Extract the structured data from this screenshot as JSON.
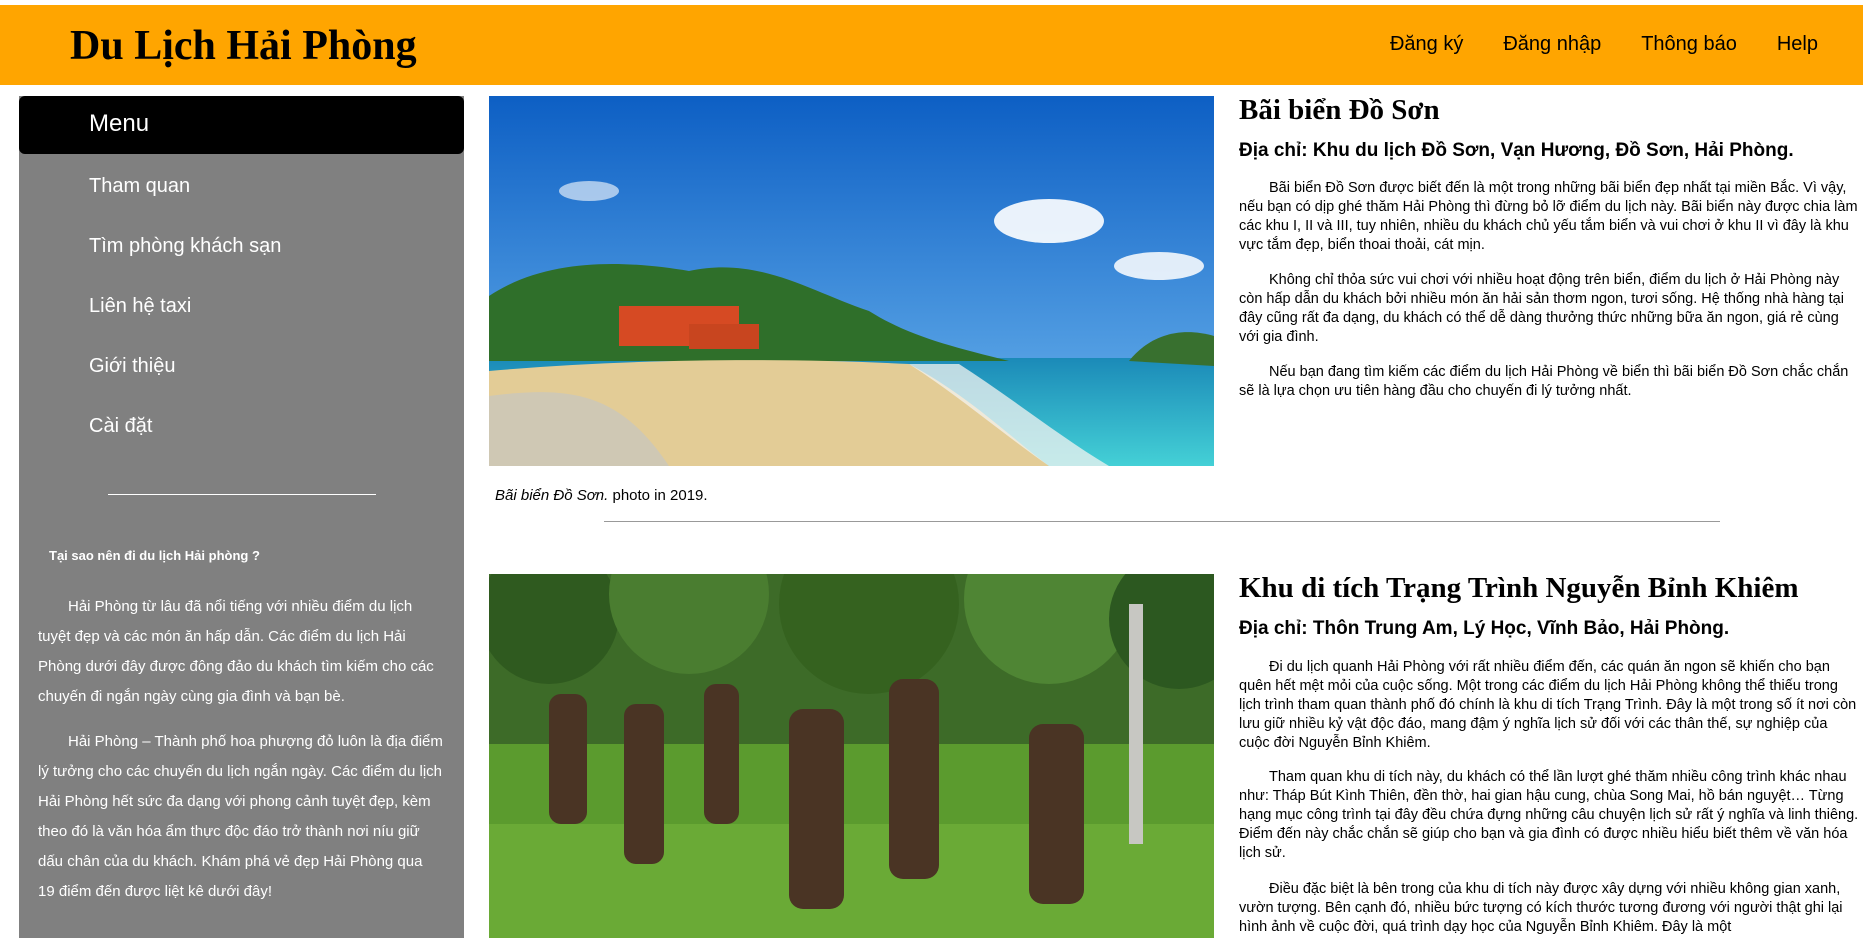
{
  "header": {
    "site_title": "Du Lịch Hải Phòng",
    "nav": [
      "Đăng ký",
      "Đăng nhập",
      "Thông báo",
      "Help"
    ]
  },
  "sidebar": {
    "menu_title": "Menu",
    "items": [
      "Tham quan",
      "Tìm phòng khách sạn",
      "Liên hệ taxi",
      "Giới thiệu",
      "Cài đặt"
    ],
    "why_title": "Tại sao nên đi du lịch Hải phòng ?",
    "paragraphs": [
      "Hải Phòng từ lâu đã nổi tiếng với nhiều điểm du lịch tuyệt đẹp và các món ăn hấp dẫn. Các điểm du lịch Hải Phòng dưới đây được đông đảo du khách tìm kiếm cho các chuyến đi ngắn ngày cùng gia đình và bạn bè.",
      "Hải Phòng – Thành phố hoa phượng đỏ luôn là địa điểm lý tưởng cho các chuyến du lịch ngắn ngày. Các điểm du lịch Hải Phòng hết sức đa dạng với phong cảnh tuyệt đẹp, kèm theo đó là văn hóa ẩm thực độc đáo trở thành nơi níu giữ dấu chân của du khách. Khám phá vẻ đẹp Hải Phòng qua 19 điểm đến được liệt kê dưới đây!"
    ]
  },
  "articles": [
    {
      "title": "Bãi biển Đồ Sơn",
      "address": "Địa chỉ: Khu du lịch Đồ Sơn, Vạn Hương, Đồ Sơn, Hải Phòng.",
      "caption_italic": "Bãi biển Đồ Sơn.",
      "caption_rest": " photo in 2019.",
      "paragraphs": [
        "Bãi biển Đồ Sơn được biết đến là một trong những bãi biển đẹp nhất tại miền Bắc. Vì vậy, nếu bạn có dịp ghé thăm Hải Phòng thì đừng bỏ lỡ điểm du lịch này. Bãi biển này được chia làm các khu I, II và III, tuy nhiên, nhiều du khách chủ yếu tắm biển và vui chơi ở khu II vì đây là khu vực tắm đẹp, biển thoai thoải, cát mịn.",
        "Không chỉ thỏa sức vui chơi với nhiều hoạt động trên biển, điểm du lịch ở Hải Phòng này còn hấp dẫn du khách bởi nhiều món ăn hải sản thơm ngon, tươi sống. Hệ thống nhà hàng tại đây cũng rất đa dạng, du khách có thể dễ dàng thưởng thức những bữa ăn ngon, giá rẻ cùng với gia đình.",
        "Nếu bạn đang tìm kiếm các điểm du lịch Hải Phòng về biển thì bãi biển Đồ Sơn chắc chắn sẽ là lựa chọn ưu tiên hàng đầu cho chuyến đi lý tưởng nhất."
      ]
    },
    {
      "title": "Khu di tích Trạng Trình Nguyễn Bỉnh Khiêm",
      "address": "Địa chỉ: Thôn Trung Am, Lý Học, Vĩnh Bảo, Hải Phòng.",
      "paragraphs": [
        "Đi du lịch quanh Hải Phòng với rất nhiều điểm đến, các quán ăn ngon sẽ khiến cho bạn quên hết mệt mỏi của cuộc sống. Một trong các điểm du lịch Hải Phòng không thể thiếu trong lịch trình tham quan thành phố đó chính là khu di tích Trạng Trình. Đây là một trong số ít nơi còn lưu giữ nhiều kỷ vật độc đáo, mang đậm ý nghĩa lịch sử đối với các thân thế, sự nghiệp của cuộc đời Nguyễn Bỉnh Khiêm.",
        "Tham quan khu di tích này, du khách có thể lần lượt ghé thăm nhiều công trình khác nhau như: Tháp Bút Kình Thiên, đền thờ, hai gian hậu cung, chùa Song Mai, hồ bán nguyệt… Từng hạng mục công trình tại đây đều chứa đựng những câu chuyện lịch sử rất ý nghĩa và linh thiêng. Điểm đến này chắc chắn sẽ giúp cho bạn và gia đình có được nhiều hiểu biết thêm về văn hóa lịch sử.",
        "Điều đặc biệt là bên trong của khu di tích này được xây dựng với nhiều không gian xanh, vườn tượng. Bên cạnh đó, nhiều bức tượng có kích thước tương đương với người thật ghi lại hình ảnh về cuộc đời, quá trình dạy học của Nguyễn Bỉnh Khiêm. Đây là một"
      ]
    }
  ]
}
